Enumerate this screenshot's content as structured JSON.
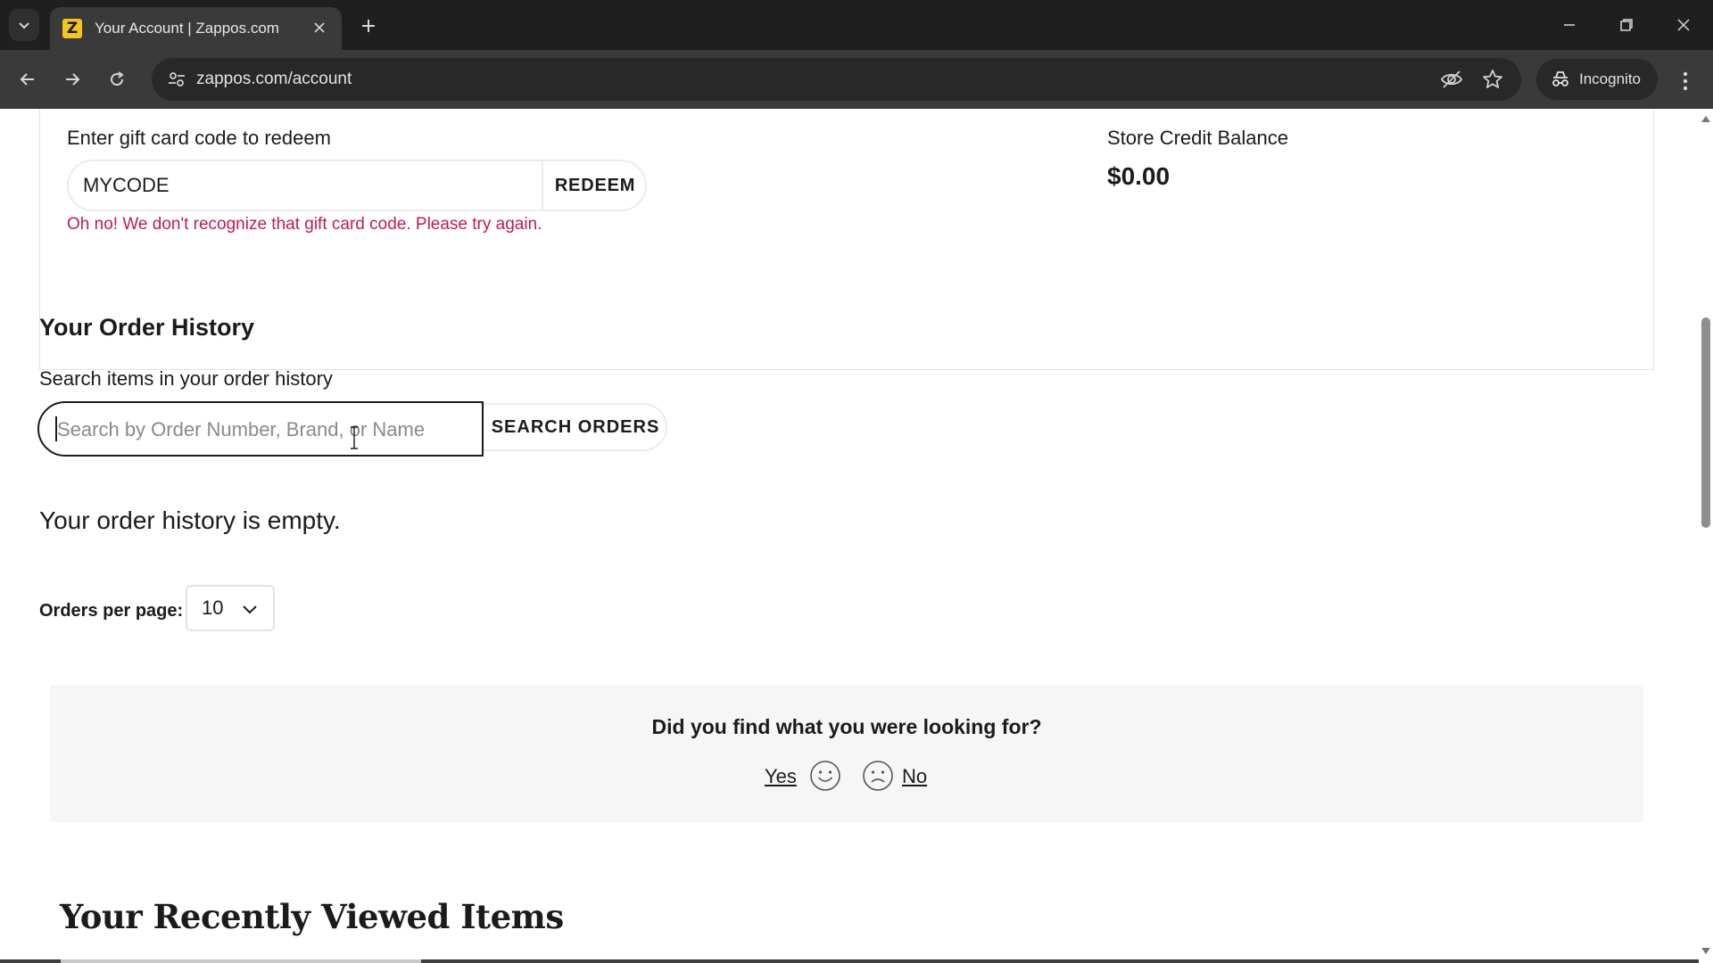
{
  "browser": {
    "tab_title": "Your Account | Zappos.com",
    "favicon_letter": "Z",
    "url": "zappos.com/account",
    "profile_label": "Incognito"
  },
  "gift_card": {
    "label": "Enter gift card code to redeem",
    "input_value": "MYCODE",
    "redeem_label": "REDEEM",
    "error": "Oh no! We don't recognize that gift card code. Please try again."
  },
  "store_credit": {
    "label": "Store Credit Balance",
    "value": "$0.00"
  },
  "order_history": {
    "title": "Your Order History",
    "search_label": "Search items in your order history",
    "search_placeholder": "Search by Order Number, Brand, or Name",
    "search_button": "SEARCH ORDERS",
    "empty_message": "Your order history is empty.",
    "per_page_label": "Orders per page:",
    "per_page_value": "10"
  },
  "feedback": {
    "question": "Did you find what you were looking for?",
    "yes_label": "Yes",
    "no_label": "No"
  },
  "recently_viewed": {
    "title": "Your Recently Viewed Items"
  },
  "icons": {
    "tab_search": "chevron-down-icon",
    "tab_close": "close-icon",
    "new_tab": "plus-icon",
    "back": "arrow-left-icon",
    "forward": "arrow-right-icon",
    "reload": "reload-icon",
    "site_info": "tune-icon",
    "eye_off": "eye-off-icon",
    "bookmark": "star-icon",
    "incognito": "incognito-icon",
    "menu": "kebab-menu-icon",
    "smile": "smile-icon",
    "frown": "frown-icon"
  },
  "colors": {
    "error": "#c2185b",
    "chrome_dark": "#1f1f1f",
    "toolbar": "#3a3a3a",
    "favicon": "#f3c51e"
  }
}
